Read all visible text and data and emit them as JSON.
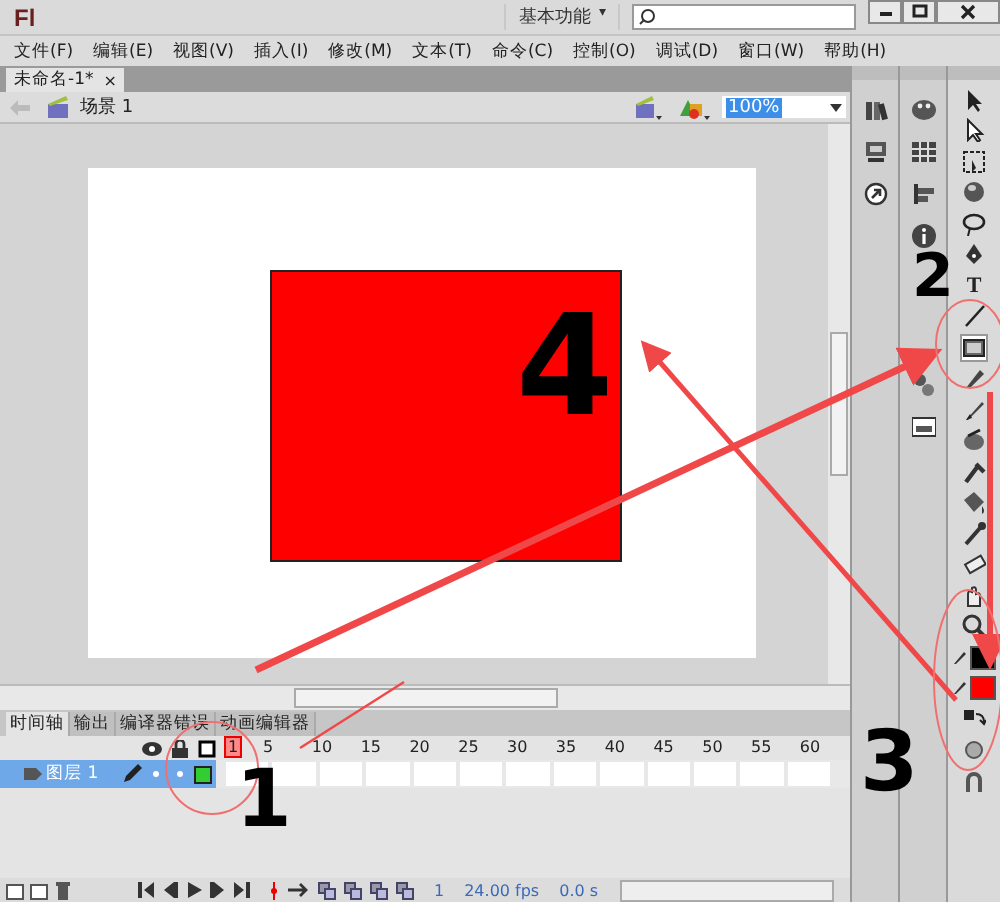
{
  "window": {
    "logo": "Fl",
    "workspace": "基本功能",
    "workspace_caret": "▾"
  },
  "menu": [
    "文件(F)",
    "编辑(E)",
    "视图(V)",
    "插入(I)",
    "修改(M)",
    "文本(T)",
    "命令(C)",
    "控制(O)",
    "调试(D)",
    "窗口(W)",
    "帮助(H)"
  ],
  "document_tab": {
    "title": "未命名-1*",
    "close": "×"
  },
  "edit_bar": {
    "scene": "场景 1",
    "zoom": "100%"
  },
  "timeline": {
    "tabs": [
      {
        "label": "时间轴",
        "selected": true
      },
      {
        "label": "输出",
        "selected": false
      },
      {
        "label": "编译器错误",
        "selected": false
      },
      {
        "label": "动画编辑器",
        "selected": false
      }
    ],
    "frame_numbers": [
      "1",
      "5",
      "10",
      "15",
      "20",
      "25",
      "30",
      "35",
      "40",
      "45",
      "50",
      "55",
      "60"
    ],
    "layers": [
      {
        "name": "图层 1",
        "selected": true,
        "color": "#33cc33"
      }
    ],
    "current_frame": "1",
    "fps": "24.00 fps",
    "time": "0.0 s"
  },
  "tools": [
    {
      "kind": "icon"
    },
    {
      "kind": "icon"
    },
    {
      "kind": "icon"
    },
    {
      "kind": "icon"
    },
    {
      "kind": "icon"
    },
    {
      "kind": "icon"
    },
    {
      "kind": "text",
      "label": "T"
    },
    {
      "kind": "icon"
    },
    {
      "kind": "icon",
      "selected": true
    },
    {
      "kind": "icon"
    },
    {
      "kind": "icon"
    },
    {
      "kind": "icon"
    },
    {
      "kind": "icon"
    },
    {
      "kind": "icon"
    },
    {
      "kind": "icon"
    },
    {
      "kind": "icon"
    },
    {
      "kind": "icon"
    },
    {
      "kind": "icon"
    },
    {
      "kind": "stroke",
      "color": "#000000"
    },
    {
      "kind": "fill",
      "color": "#ff0000"
    },
    {
      "kind": "icon"
    },
    {
      "kind": "icon"
    },
    {
      "kind": "icon"
    }
  ],
  "annotations": [
    "1",
    "2",
    "3",
    "4"
  ]
}
